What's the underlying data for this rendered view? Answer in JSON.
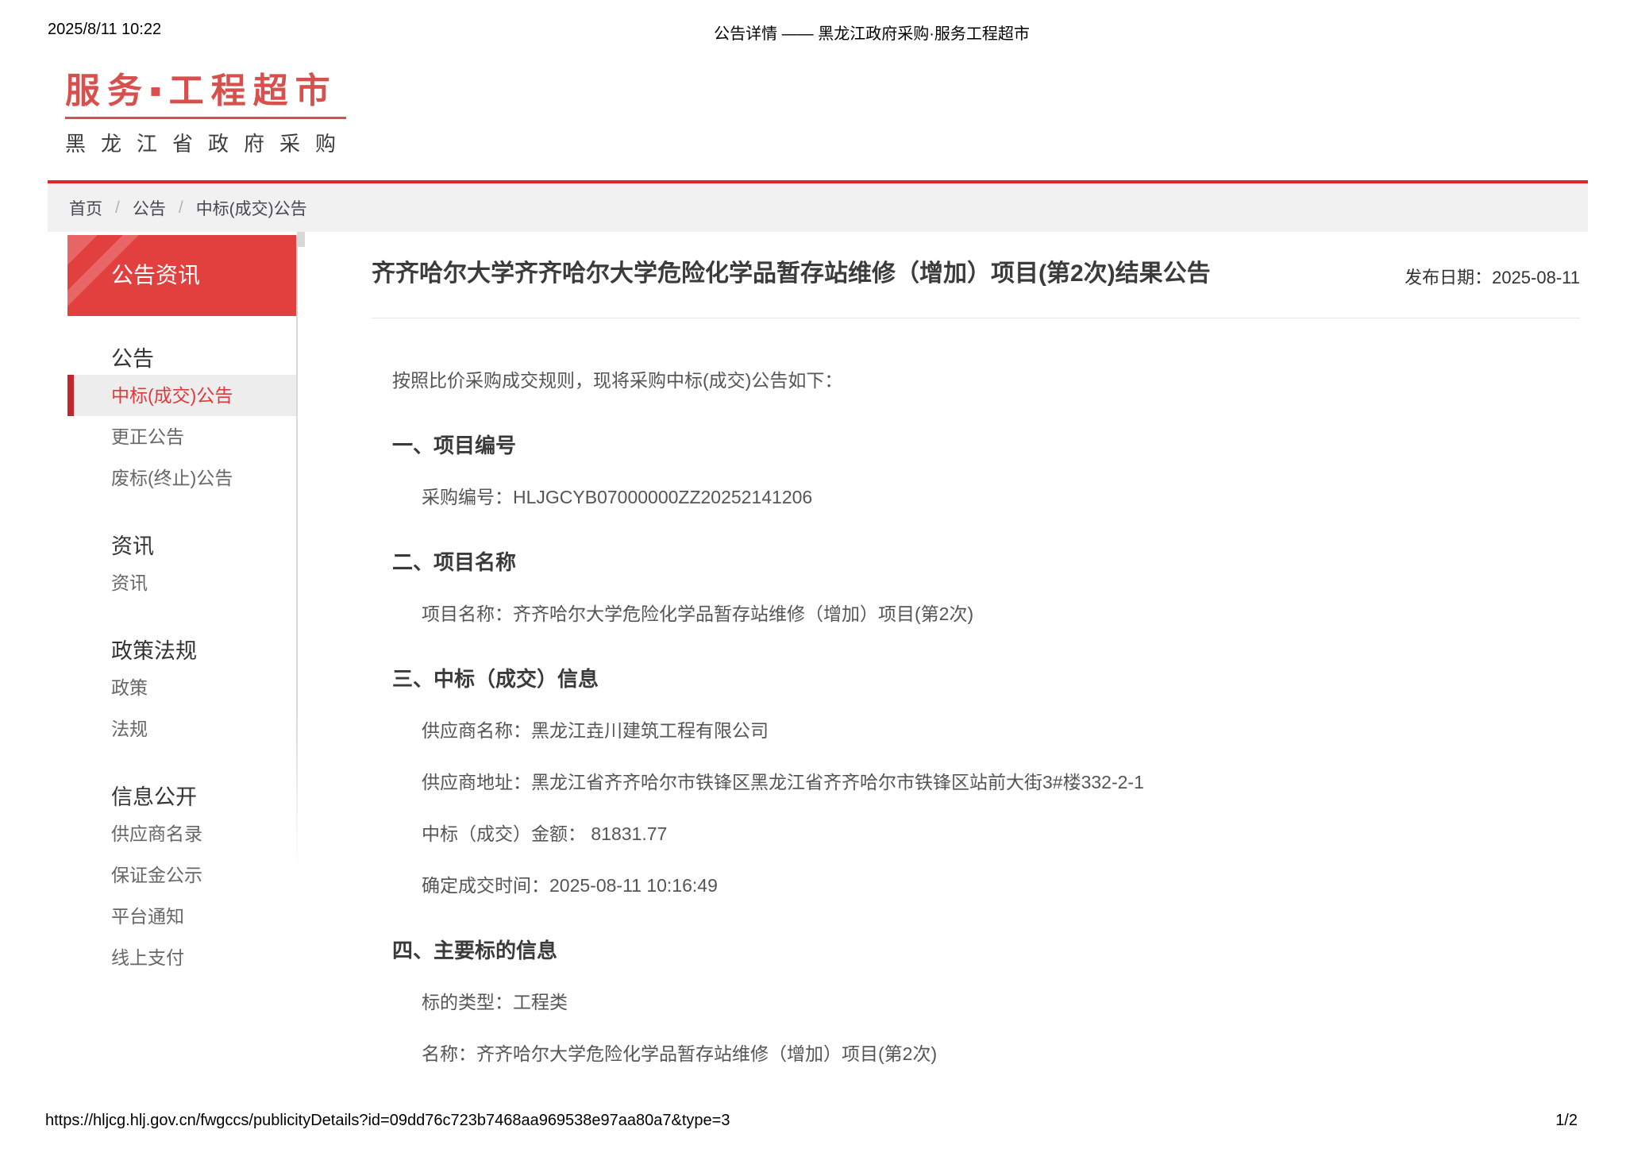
{
  "print_header": {
    "datetime": "2025/8/11 10:22",
    "title": "公告详情 —— 黑龙江政府采购·服务工程超市"
  },
  "logo": {
    "main": "服务▪工程超市",
    "sub": "黑龙江省政府采购"
  },
  "breadcrumb": {
    "separator": "/",
    "items": [
      "首页",
      "公告",
      "中标(成交)公告"
    ]
  },
  "sidebar": {
    "panel_title": "公告资讯",
    "active_item": "中标(成交)公告",
    "groups": [
      {
        "header": "公告",
        "items": [
          "中标(成交)公告",
          "更正公告",
          "废标(终止)公告"
        ]
      },
      {
        "header": "资讯",
        "items": [
          "资讯"
        ]
      },
      {
        "header": "政策法规",
        "items": [
          "政策",
          "法规"
        ]
      },
      {
        "header": "信息公开",
        "items": [
          "供应商名录",
          "保证金公示",
          "平台通知",
          "线上支付"
        ]
      }
    ]
  },
  "article": {
    "title": "齐齐哈尔大学齐齐哈尔大学危险化学品暂存站维修（增加）项目(第2次)结果公告",
    "publish_date": "发布日期：2025-08-11",
    "intro": "按照比价采购成交规则，现将采购中标(成交)公告如下：",
    "sections": [
      {
        "heading": "一、项目编号",
        "lines": [
          "采购编号：HLJGCYB07000000ZZ20252141206"
        ]
      },
      {
        "heading": "二、项目名称",
        "lines": [
          "项目名称：齐齐哈尔大学危险化学品暂存站维修（增加）项目(第2次)"
        ]
      },
      {
        "heading": "三、中标（成交）信息",
        "lines": [
          "供应商名称：黑龙江垚川建筑工程有限公司",
          "供应商地址：黑龙江省齐齐哈尔市铁锋区黑龙江省齐齐哈尔市铁锋区站前大街3#楼332-2-1",
          "中标（成交）金额： 81831.77",
          "确定成交时间：2025-08-11 10:16:49"
        ]
      },
      {
        "heading": "四、主要标的信息",
        "lines": [
          "标的类型：工程类",
          "名称：齐齐哈尔大学危险化学品暂存站维修（增加）项目(第2次)"
        ]
      }
    ]
  },
  "print_footer": {
    "url": "https://hljcg.hlj.gov.cn/fwgccs/publicityDetails?id=09dd76c723b7468aa969538e97aa80a7&type=3",
    "page": "1/2"
  },
  "colors": {
    "accent_red": "#e0262c",
    "logo_red": "#d8504d",
    "sidebar_red": "#e2403f",
    "active_red": "#de3a3d"
  }
}
